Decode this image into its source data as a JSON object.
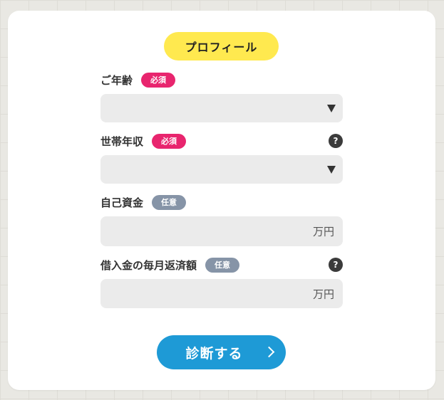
{
  "colors": {
    "accent_yellow": "#ffe94f",
    "required_badge": "#e8256e",
    "optional_badge": "#8694a7",
    "primary_button": "#1e9ad6"
  },
  "title": "プロフィール",
  "fields": [
    {
      "label": "ご年齢",
      "badge": "必須",
      "badge_type": "required",
      "control": "select",
      "value": "",
      "help": false
    },
    {
      "label": "世帯年収",
      "badge": "必須",
      "badge_type": "required",
      "control": "select",
      "value": "",
      "help": true,
      "help_glyph": "?"
    },
    {
      "label": "自己資金",
      "badge": "任意",
      "badge_type": "optional",
      "control": "text",
      "value": "",
      "unit": "万円",
      "help": false
    },
    {
      "label": "借入金の毎月返済額",
      "badge": "任意",
      "badge_type": "optional",
      "control": "text",
      "value": "",
      "unit": "万円",
      "help": true,
      "help_glyph": "?"
    }
  ],
  "submit": {
    "label": "診断する",
    "icon": "chevron-right-icon"
  }
}
